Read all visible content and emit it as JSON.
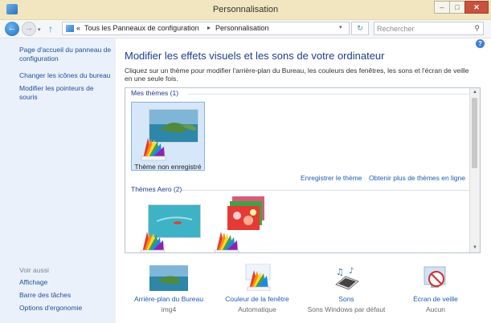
{
  "window": {
    "title": "Personnalisation",
    "controls": {
      "minimize": "–",
      "maximize": "□",
      "close": "✕"
    }
  },
  "address_bar": {
    "history_arrow": "▾",
    "up_arrow": "↑",
    "chevrons": "«",
    "breadcrumbs": [
      "Tous les Panneaux de configuration",
      "Personnalisation"
    ],
    "separator": "▸",
    "dropdown": "▾",
    "refresh": "↻",
    "search_placeholder": "Rechercher"
  },
  "sidebar": {
    "links": [
      "Page d'accueil du panneau de configuration",
      "Changer les icônes du bureau",
      "Modifier les pointeurs de souris"
    ],
    "see_also_heading": "Voir aussi",
    "see_also": [
      "Affichage",
      "Barre des tâches",
      "Options d'ergonomie"
    ]
  },
  "main": {
    "help": "?",
    "title": "Modifier les effets visuels et les sons de votre ordinateur",
    "description": "Cliquez sur un thème pour modifier l'arrière-plan du Bureau, les couleurs des fenêtres, les sons et l'écran de veille en une seule fois.",
    "my_themes": {
      "heading": "Mes thèmes (1)",
      "items": [
        {
          "name": "Thème non enregistré",
          "selected": true
        }
      ]
    },
    "links": {
      "save_theme": "Enregistrer le thème",
      "more_themes": "Obtenir plus de thèmes en ligne"
    },
    "aero_themes": {
      "heading": "Thèmes Aero (2)"
    }
  },
  "settings": [
    {
      "title": "Arrière-plan du Bureau",
      "value": "img4",
      "icon": "desktop-background-icon"
    },
    {
      "title": "Couleur de la fenêtre",
      "value": "Automatique",
      "icon": "window-color-icon"
    },
    {
      "title": "Sons",
      "value": "Sons Windows par défaut",
      "icon": "sounds-icon"
    },
    {
      "title": "Écran de veille",
      "value": "Aucun",
      "icon": "screensaver-icon"
    }
  ],
  "colors": {
    "accent": "#1f5bb0",
    "title_bar": "#f1e6bf",
    "sidebar": "#eaf1fb",
    "close": "#c7523f"
  }
}
